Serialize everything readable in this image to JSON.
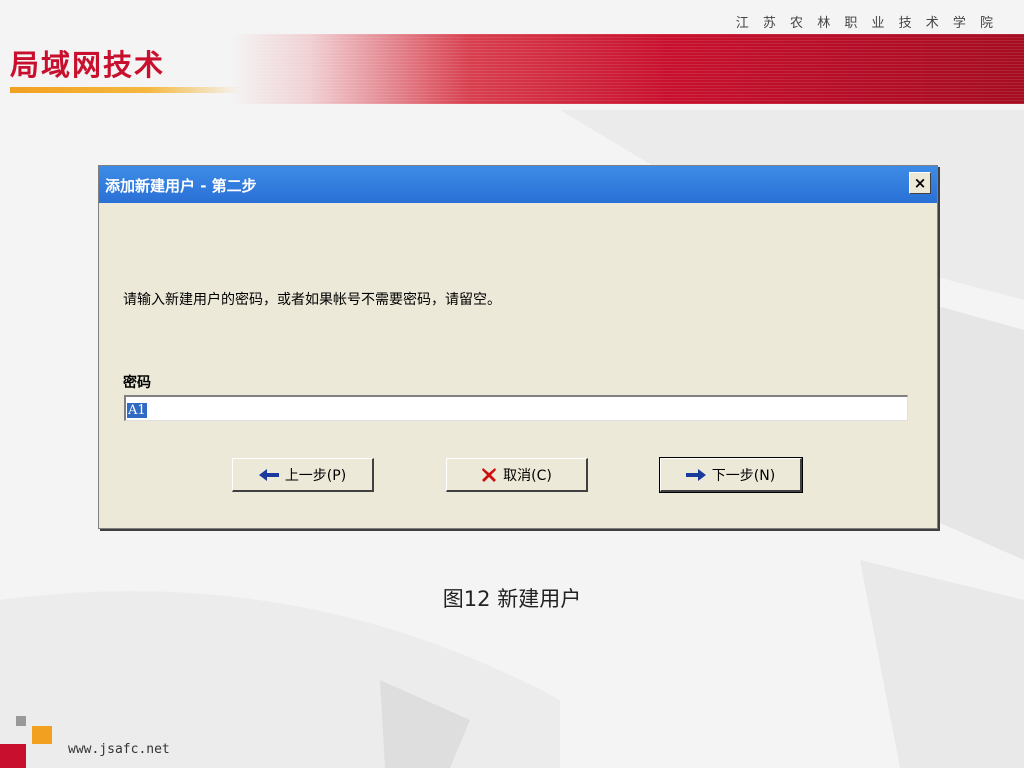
{
  "header": {
    "college_name": "江 苏 农 林 职 业 技 术 学 院",
    "course_title": "局域网技术"
  },
  "dialog": {
    "title": "添加新建用户 - 第二步",
    "close_symbol": "×",
    "instruction": "请输入新建用户的密码，或者如果帐号不需要密码，请留空。",
    "password_label": "密码",
    "password_value": "A1",
    "buttons": {
      "back_label": "上一步(P)",
      "cancel_label": "取消(C)",
      "next_label": "下一步(N)"
    }
  },
  "caption": "图12 新建用户",
  "footer": {
    "url": "www.jsafc.net"
  },
  "colors": {
    "accent_red": "#c8102e",
    "titlebar_blue": "#2a70d6",
    "dialog_bg": "#ece9d8",
    "orange": "#f2a020"
  },
  "icons": [
    "close-icon",
    "left-arrow-icon",
    "x-mark-icon",
    "right-arrow-icon"
  ]
}
